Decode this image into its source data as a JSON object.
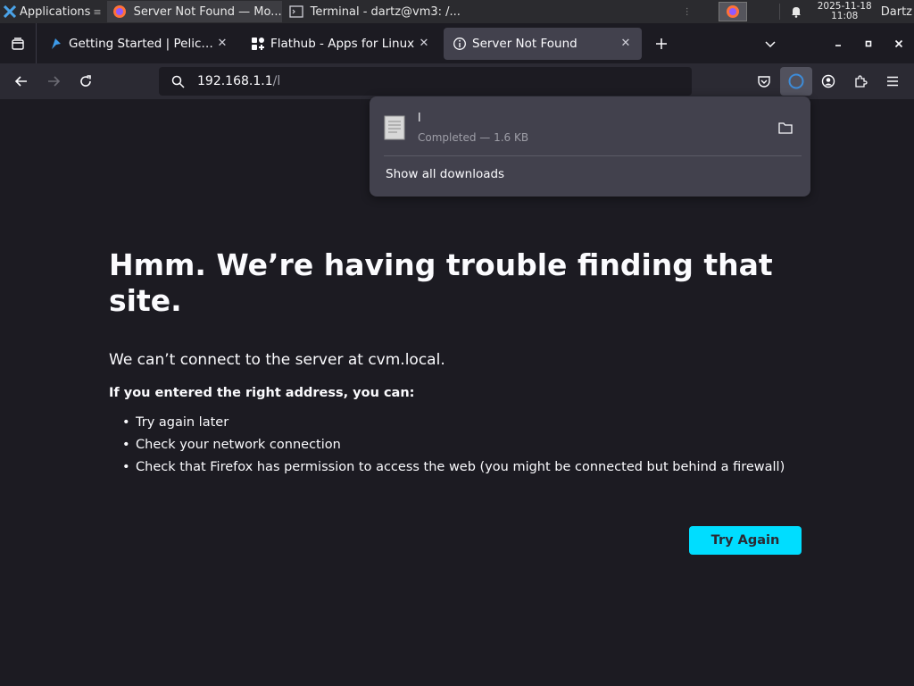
{
  "panel": {
    "apps_label": "Applications",
    "tasks": [
      {
        "title": "Server Not Found — Mo...",
        "icon": "firefox-icon"
      },
      {
        "title": "Terminal - dartz@vm3: /...",
        "icon": "terminal-icon"
      }
    ],
    "clock_date": "2025-11-18",
    "clock_time": "11:08",
    "user": "Dartz"
  },
  "tabs": [
    {
      "title": "Getting Started | Pelican",
      "icon": "pelican-icon"
    },
    {
      "title": "Flathub - Apps for Linux",
      "icon": "flathub-icon"
    },
    {
      "title": "Server Not Found",
      "icon": "info-icon",
      "selected": true
    }
  ],
  "url": {
    "host": "192.168.1.1",
    "path": "/l"
  },
  "downloads": {
    "file_name": "l",
    "status": "Completed — 1.6 KB",
    "show_all": "Show all downloads"
  },
  "error": {
    "title": "Hmm. We’re having trouble finding that site.",
    "intro": "We can’t connect to the server at cvm.local.",
    "advice_heading": "If you entered the right address, you can:",
    "suggestions": [
      "Try again later",
      "Check your network connection",
      "Check that Firefox has permission to access the web (you might be connected but behind a firewall)"
    ],
    "try_again_label": "Try Again"
  },
  "colors": {
    "accent": "#00ddff",
    "background": "#1c1b22",
    "toolbar": "#2b2a33"
  }
}
